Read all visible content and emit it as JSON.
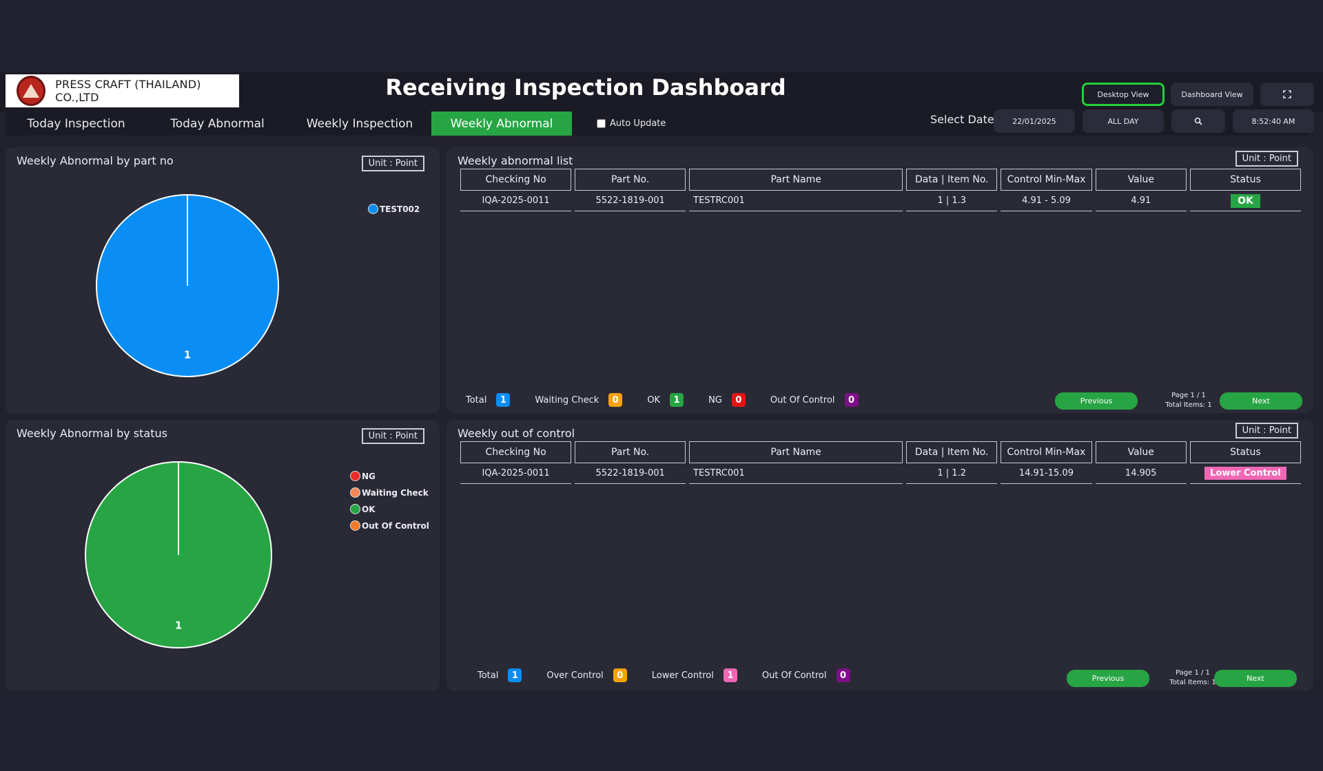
{
  "header": {
    "company": "PRESS CRAFT (THAILAND) CO.,LTD",
    "title": "Receiving Inspection Dashboard",
    "desktop_view": "Desktop View",
    "dashboard_view": "Dashboard View",
    "fullscreen_icon": "expand-icon"
  },
  "tabs": [
    {
      "label": "Today Inspection",
      "active": false
    },
    {
      "label": "Today Abnormal",
      "active": false
    },
    {
      "label": "Weekly Inspection",
      "active": false
    },
    {
      "label": "Weekly Abnormal",
      "active": true
    }
  ],
  "auto_update": {
    "label": "Auto Update",
    "checked": false
  },
  "filters": {
    "select_date_label": "Select Date",
    "date": "22/01/2025",
    "period": "ALL DAY",
    "search_icon": "search-icon",
    "time": "8:52:40 AM"
  },
  "unit_label": "Unit : Point",
  "panel_part": {
    "title": "Weekly Abnormal by part no",
    "chart_data": {
      "type": "pie",
      "categories": [
        "TEST002"
      ],
      "values": [
        1
      ],
      "colors": [
        "#0a8ef5"
      ],
      "legend_position": "right"
    }
  },
  "panel_status": {
    "title": "Weekly Abnormal by status",
    "chart_data": {
      "type": "pie",
      "categories": [
        "NG",
        "Waiting Check",
        "OK",
        "Out Of Control"
      ],
      "values": [
        0,
        0,
        1,
        0
      ],
      "colors": [
        "#ee2b2b",
        "#f2885a",
        "#27a544",
        "#f27a2a"
      ],
      "legend_position": "right"
    }
  },
  "abnormal_list": {
    "title": "Weekly abnormal list",
    "columns": [
      "Checking No",
      "Part No.",
      "Part Name",
      "Data | Item No.",
      "Control Min-Max",
      "Value",
      "Status"
    ],
    "rows": [
      {
        "checking_no": "IQA-2025-0011",
        "part_no": "5522-1819-001",
        "part_name": "TESTRC001",
        "data_item": "1 | 1.3",
        "control": "4.91 - 5.09",
        "value": "4.91",
        "status": "OK"
      }
    ],
    "summary": [
      {
        "label": "Total",
        "count": "1",
        "color": "#0a8ef5"
      },
      {
        "label": "Waiting Check",
        "count": "0",
        "color": "#f5a20a"
      },
      {
        "label": "OK",
        "count": "1",
        "color": "#27a544"
      },
      {
        "label": "NG",
        "count": "0",
        "color": "#e81212"
      },
      {
        "label": "Out Of Control",
        "count": "0",
        "color": "#7d0f86"
      }
    ],
    "pagination": {
      "previous": "Previous",
      "next": "Next",
      "page": "Page 1 / 1",
      "total": "Total Items: 1"
    }
  },
  "out_of_control": {
    "title": "Weekly out of control",
    "columns": [
      "Checking No",
      "Part No.",
      "Part Name",
      "Data | Item No.",
      "Control Min-Max",
      "Value",
      "Status"
    ],
    "rows": [
      {
        "checking_no": "IQA-2025-0011",
        "part_no": "5522-1819-001",
        "part_name": "TESTRC001",
        "data_item": "1 | 1.2",
        "control": "14.91-15.09",
        "value": "14.905",
        "status": "Lower Control"
      }
    ],
    "summary": [
      {
        "label": "Total",
        "count": "1",
        "color": "#0a8ef5"
      },
      {
        "label": "Over Control",
        "count": "0",
        "color": "#f5a20a"
      },
      {
        "label": "Lower Control",
        "count": "1",
        "color": "#f067b5"
      },
      {
        "label": "Out Of Control",
        "count": "0",
        "color": "#7d0f86"
      }
    ],
    "pagination": {
      "previous": "Previous",
      "next": "Next",
      "page": "Page 1 / 1",
      "total": "Total Items: 1"
    }
  }
}
